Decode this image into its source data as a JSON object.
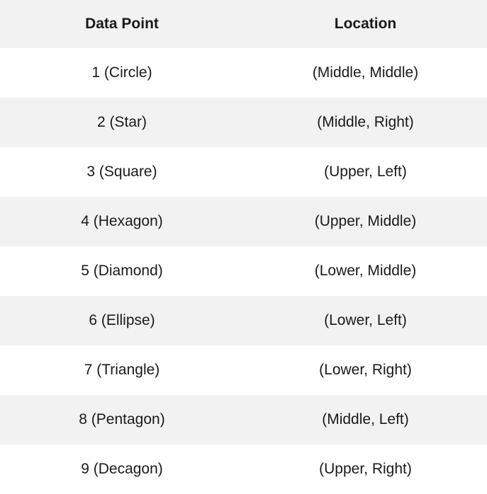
{
  "table": {
    "headers": [
      "Data Point",
      "Location"
    ],
    "rows": [
      [
        "1 (Circle)",
        "(Middle, Middle)"
      ],
      [
        "2 (Star)",
        "(Middle, Right)"
      ],
      [
        "3 (Square)",
        "(Upper, Left)"
      ],
      [
        "4 (Hexagon)",
        "(Upper, Middle)"
      ],
      [
        "5 (Diamond)",
        "(Lower, Middle)"
      ],
      [
        "6 (Ellipse)",
        "(Lower, Left)"
      ],
      [
        "7 (Triangle)",
        "(Lower, Right)"
      ],
      [
        "8 (Pentagon)",
        "(Middle, Left)"
      ],
      [
        "9 (Decagon)",
        "(Upper, Right)"
      ]
    ]
  },
  "colors": {
    "stripe": "#f2f2f2",
    "background": "#ffffff",
    "text": "#1a1a1a"
  }
}
